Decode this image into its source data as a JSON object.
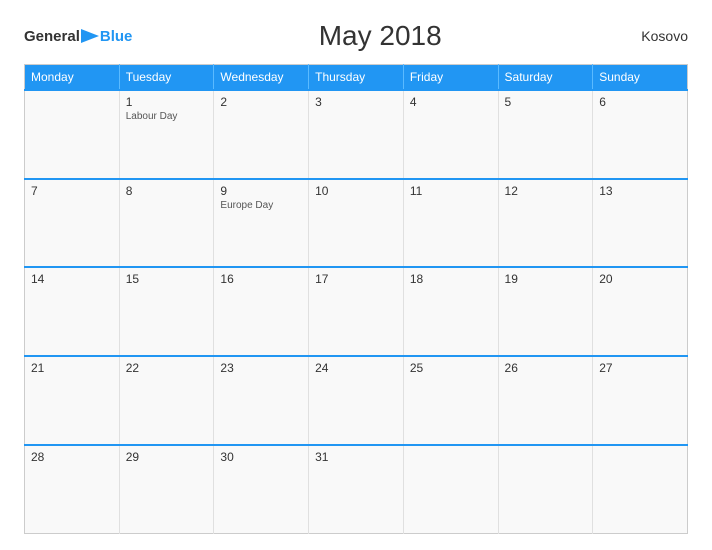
{
  "header": {
    "logo_general": "General",
    "logo_blue": "Blue",
    "title": "May 2018",
    "country": "Kosovo"
  },
  "days_of_week": [
    "Monday",
    "Tuesday",
    "Wednesday",
    "Thursday",
    "Friday",
    "Saturday",
    "Sunday"
  ],
  "weeks": [
    [
      {
        "day": "",
        "empty": true
      },
      {
        "day": "1",
        "holiday": "Labour Day"
      },
      {
        "day": "2",
        "holiday": ""
      },
      {
        "day": "3",
        "holiday": ""
      },
      {
        "day": "4",
        "holiday": ""
      },
      {
        "day": "5",
        "holiday": ""
      },
      {
        "day": "6",
        "holiday": ""
      }
    ],
    [
      {
        "day": "7",
        "holiday": ""
      },
      {
        "day": "8",
        "holiday": ""
      },
      {
        "day": "9",
        "holiday": "Europe Day"
      },
      {
        "day": "10",
        "holiday": ""
      },
      {
        "day": "11",
        "holiday": ""
      },
      {
        "day": "12",
        "holiday": ""
      },
      {
        "day": "13",
        "holiday": ""
      }
    ],
    [
      {
        "day": "14",
        "holiday": ""
      },
      {
        "day": "15",
        "holiday": ""
      },
      {
        "day": "16",
        "holiday": ""
      },
      {
        "day": "17",
        "holiday": ""
      },
      {
        "day": "18",
        "holiday": ""
      },
      {
        "day": "19",
        "holiday": ""
      },
      {
        "day": "20",
        "holiday": ""
      }
    ],
    [
      {
        "day": "21",
        "holiday": ""
      },
      {
        "day": "22",
        "holiday": ""
      },
      {
        "day": "23",
        "holiday": ""
      },
      {
        "day": "24",
        "holiday": ""
      },
      {
        "day": "25",
        "holiday": ""
      },
      {
        "day": "26",
        "holiday": ""
      },
      {
        "day": "27",
        "holiday": ""
      }
    ],
    [
      {
        "day": "28",
        "holiday": ""
      },
      {
        "day": "29",
        "holiday": ""
      },
      {
        "day": "30",
        "holiday": ""
      },
      {
        "day": "31",
        "holiday": ""
      },
      {
        "day": "",
        "empty": true
      },
      {
        "day": "",
        "empty": true
      },
      {
        "day": "",
        "empty": true
      }
    ]
  ]
}
